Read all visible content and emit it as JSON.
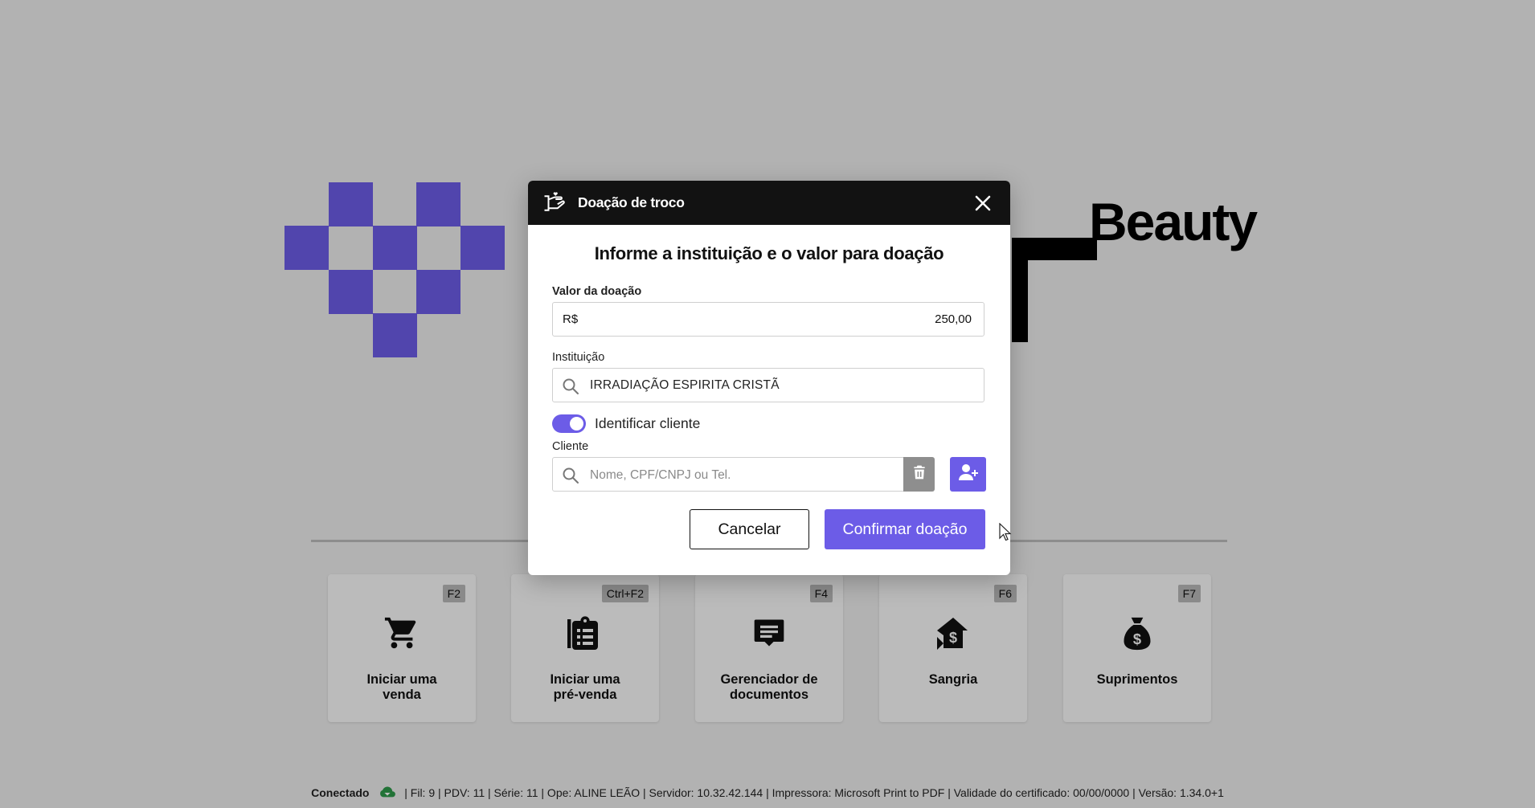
{
  "brand": {
    "word": "Beauty",
    "pixel_color": "#6c5ce7"
  },
  "shortcuts": [
    {
      "key": "F2",
      "label": "Iniciar uma\nvenda",
      "icon": "cart-icon"
    },
    {
      "key": "Ctrl+F2",
      "label": "Iniciar uma\npré-venda",
      "icon": "clipboard-list-icon"
    },
    {
      "key": "F4",
      "label": "Gerenciador de\ndocumentos",
      "icon": "document-message-icon"
    },
    {
      "key": "F6",
      "label": "Sangria",
      "icon": "money-up-icon"
    },
    {
      "key": "F7",
      "label": "Suprimentos",
      "icon": "money-bag-icon"
    }
  ],
  "status": {
    "connection": "Conectado",
    "details": "| Fil: 9 | PDV: 11 | Série: 11 | Ope: ALINE LEÃO | Servidor: 10.32.42.144 | Impressora: Microsoft Print to PDF | Validade do certificado: 00/00/0000 | Versão: 1.34.0+1"
  },
  "modal": {
    "title": "Doação de troco",
    "heading": "Informe a instituição e o valor para doação",
    "amount": {
      "label": "Valor da doação",
      "currency": "R$",
      "value": "250,00"
    },
    "institution": {
      "label": "Instituição",
      "value": "IRRADIAÇÃO ESPIRITA CRISTÃ"
    },
    "identify_toggle": {
      "label": "Identificar cliente",
      "on": true
    },
    "client": {
      "label": "Cliente",
      "placeholder": "Nome, CPF/CNPJ ou Tel."
    },
    "cancel_label": "Cancelar",
    "confirm_label": "Confirmar doação"
  },
  "colors": {
    "accent": "#6c5ce7",
    "header_bg": "#121212",
    "connected_green": "#2e9a4a"
  }
}
